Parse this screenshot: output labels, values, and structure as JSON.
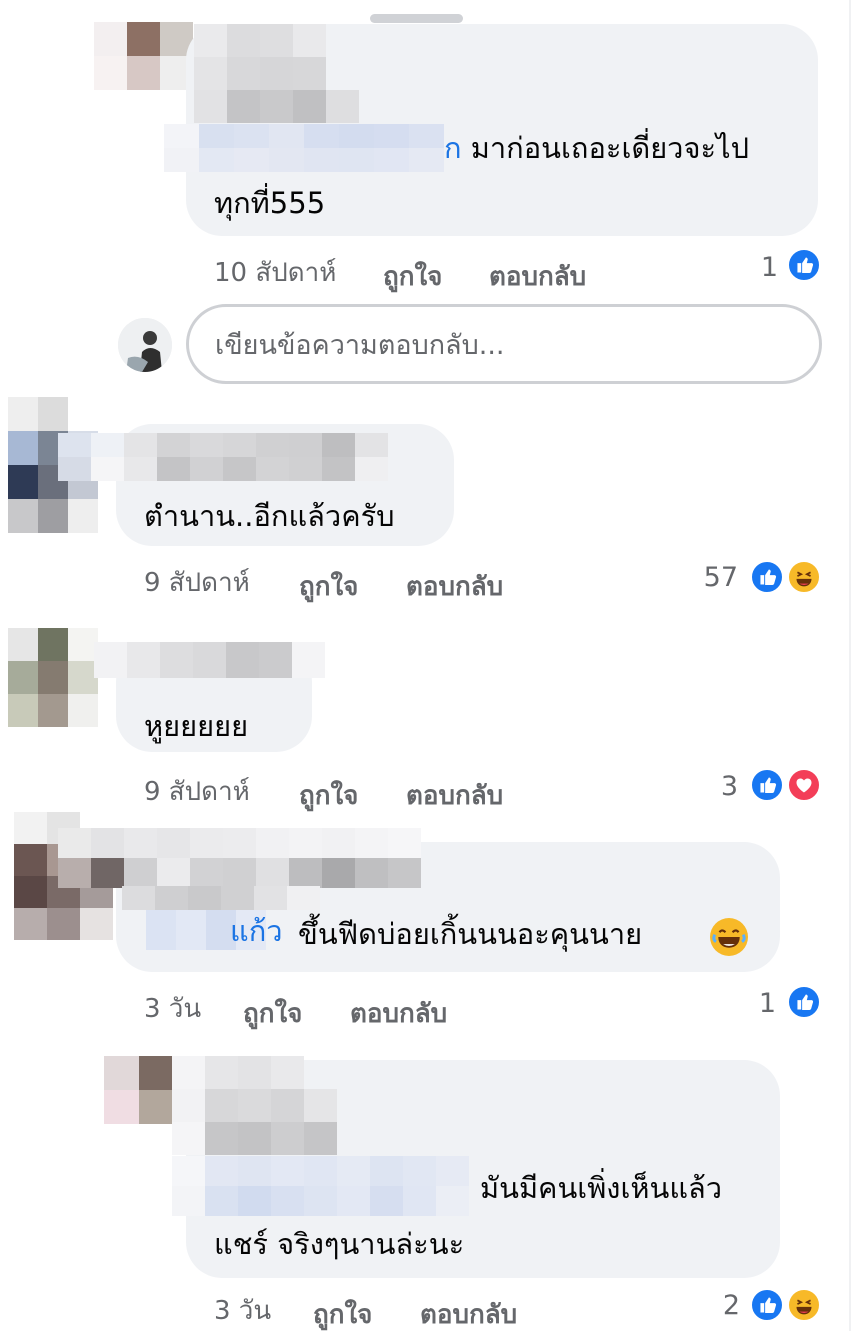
{
  "comments": [
    {
      "mention_tail": "ก",
      "text_line1": "มาก่อนเถอะเดี่ยวจะไป",
      "text_line2": "ทุกที่555",
      "time": "10 สัปดาห์",
      "like_label": "ถูกใจ",
      "reply_label": "ตอบกลับ",
      "reaction_count": "1",
      "reactions": [
        "like-icon"
      ]
    },
    {
      "text_line1": "ตำนาน..อีกแล้วครับ",
      "time": "9 สัปดาห์",
      "like_label": "ถูกใจ",
      "reply_label": "ตอบกลับ",
      "reaction_count": "57",
      "reactions": [
        "like-icon",
        "haha-icon"
      ]
    },
    {
      "text_line1": "หูยยยยย",
      "time": "9 สัปดาห์",
      "like_label": "ถูกใจ",
      "reply_label": "ตอบกลับ",
      "reaction_count": "3",
      "reactions": [
        "like-icon",
        "love-icon"
      ]
    },
    {
      "mention_partial": "แก้ว",
      "text_line1": "ขึ้นฟีดบ่อยเกิ้นนนอะคุนนาย",
      "time": "3 วัน",
      "like_label": "ถูกใจ",
      "reply_label": "ตอบกลับ",
      "reaction_count": "1",
      "reactions": [
        "like-icon"
      ]
    },
    {
      "text_line1": "มันมีคนเพิ่งเห็นแล้ว",
      "text_line2": "แชร์ จริงๆนานล่ะนะ",
      "time": "3 วัน",
      "like_label": "ถูกใจ",
      "reply_label": "ตอบกลับ",
      "reaction_count": "2",
      "reactions": [
        "like-icon",
        "haha-icon"
      ]
    }
  ],
  "reply_input": {
    "placeholder": "เขียนข้อความตอบกลับ..."
  },
  "colors": {
    "bubble": "#f0f2f5",
    "mention": "#1b74e4",
    "meta": "#65676b",
    "like": "#1877f2",
    "love": "#f33e58",
    "haha": "#f7b928"
  }
}
